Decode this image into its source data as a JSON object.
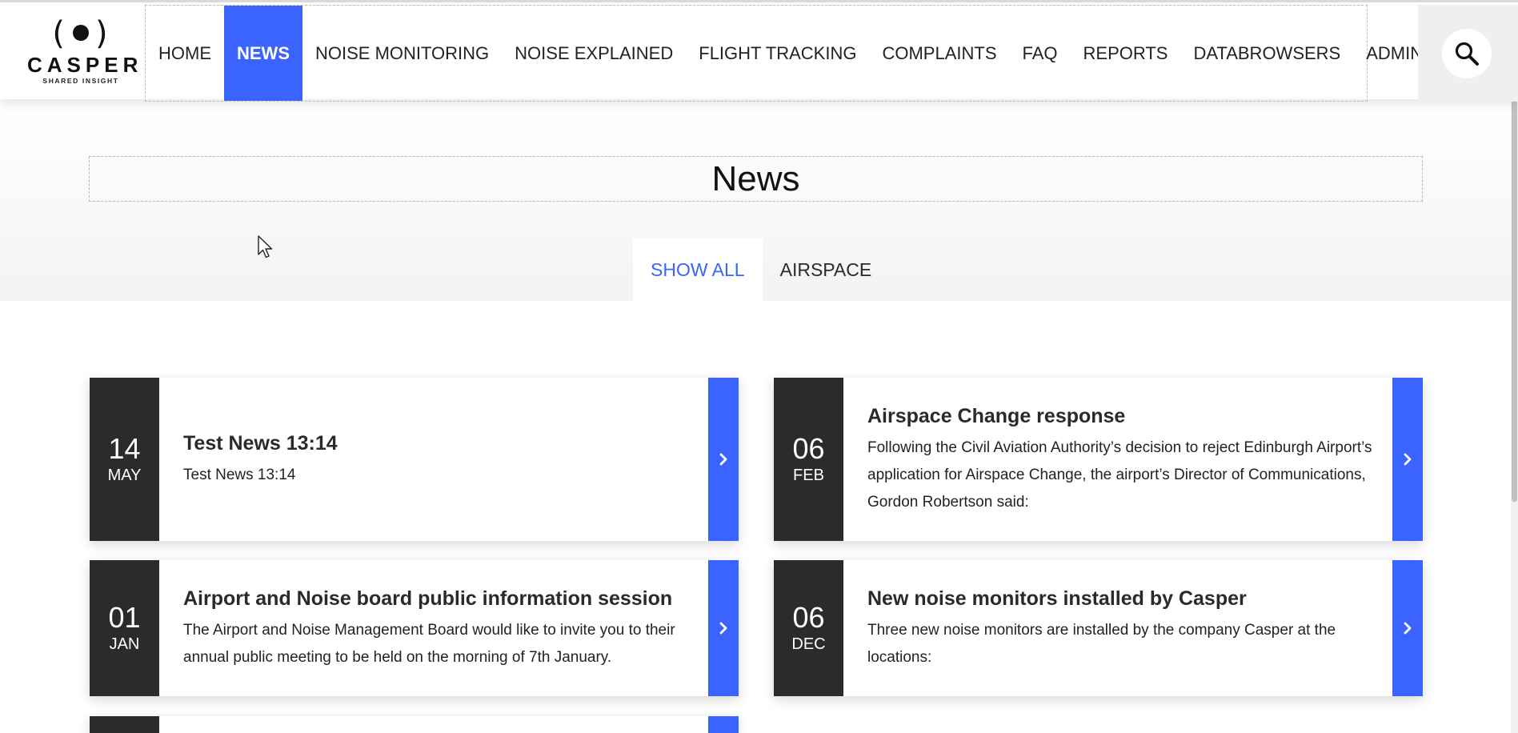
{
  "logo": {
    "name": "CASPER",
    "tagline": "SHARED INSIGHT"
  },
  "nav": {
    "items": [
      {
        "label": "HOME"
      },
      {
        "label": "NEWS"
      },
      {
        "label": "NOISE MONITORING"
      },
      {
        "label": "NOISE EXPLAINED"
      },
      {
        "label": "FLIGHT TRACKING"
      },
      {
        "label": "COMPLAINTS"
      },
      {
        "label": "FAQ"
      },
      {
        "label": "REPORTS"
      },
      {
        "label": "DATABROWSERS"
      },
      {
        "label": "ADMIN"
      }
    ],
    "active": "NEWS",
    "search_icon": "search-icon"
  },
  "page": {
    "title": "News"
  },
  "tabs": [
    {
      "label": "SHOW ALL",
      "active": true
    },
    {
      "label": "AIRSPACE",
      "active": false
    }
  ],
  "articles": [
    {
      "day": "14",
      "month": "MAY",
      "title": "Test News 13:14",
      "summary": "Test News 13:14"
    },
    {
      "day": "06",
      "month": "FEB",
      "title": "Airspace Change response",
      "summary": "Following the Civil Aviation Authority’s decision to reject Edinburgh Airport’s application for Airspace Change, the airport’s Director of Communications, Gordon Robertson said:"
    },
    {
      "day": "01",
      "month": "JAN",
      "title": "Airport and Noise board public information session",
      "summary": "The Airport and Noise Management Board would like to invite you to their annual public meeting to be held on the morning of 7th January."
    },
    {
      "day": "06",
      "month": "DEC",
      "title": "New noise monitors installed by Casper",
      "summary": "Three new noise monitors are installed by the company Casper at the locations:"
    }
  ],
  "colors": {
    "accent": "#3a63ff",
    "date_bg": "#2b2b2b"
  }
}
